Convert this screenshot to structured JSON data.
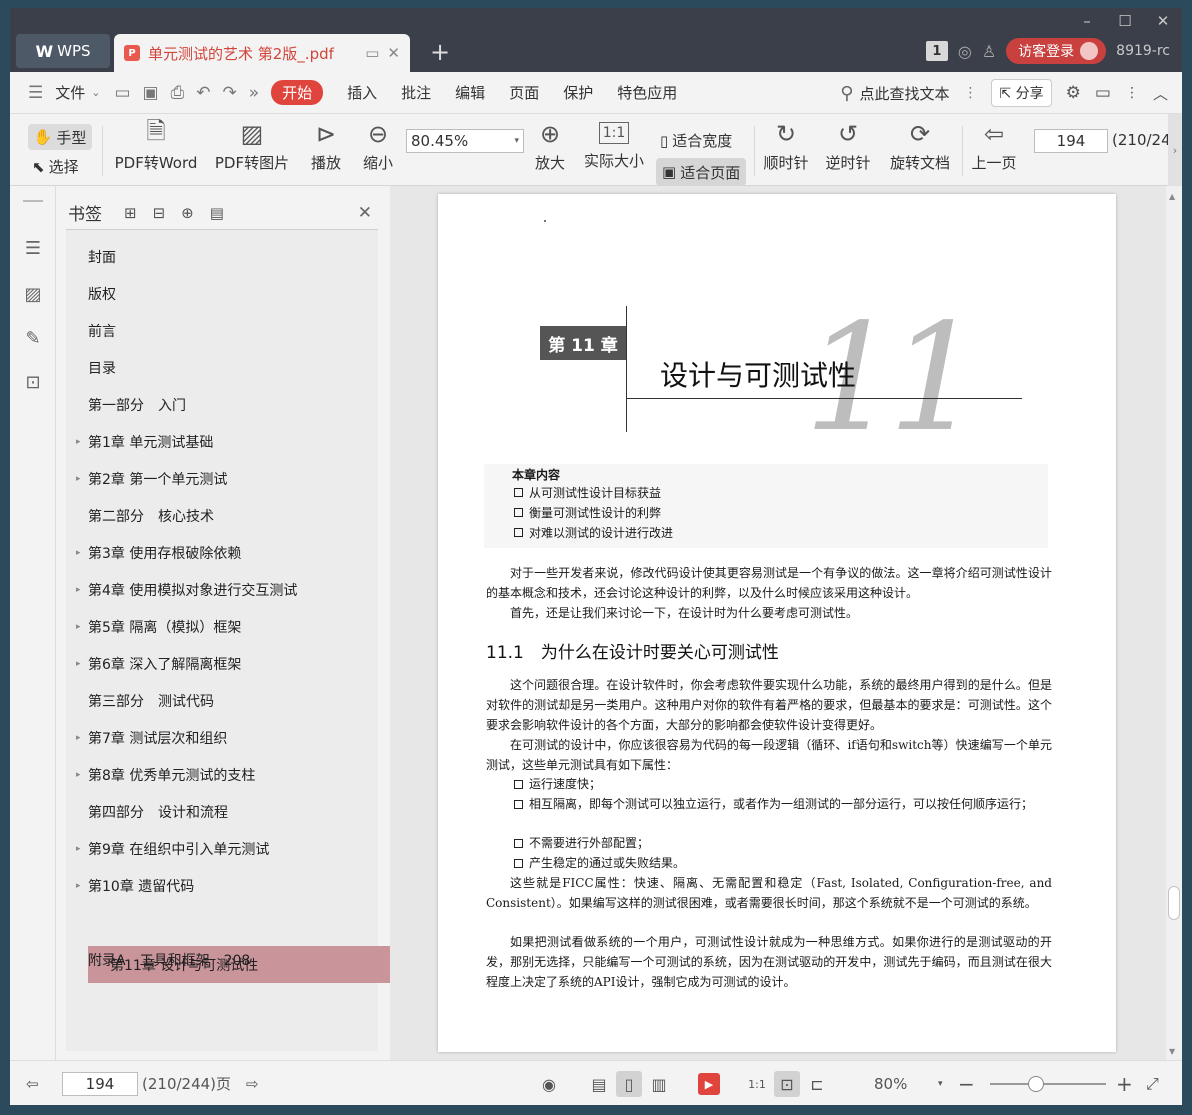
{
  "titlebar": {
    "app_tab": "WPS",
    "doc_tab": "单元测试的艺术 第2版_.pdf",
    "plus": "+",
    "num_badge": "1",
    "login": "访客登录",
    "version": "8919-rc",
    "win_min": "–",
    "win_max": "☐",
    "win_close": "✕"
  },
  "menu": {
    "file": "文件",
    "start": "开始",
    "insert": "插入",
    "annotate": "批注",
    "edit": "编辑",
    "page": "页面",
    "protect": "保护",
    "special": "特色应用",
    "search": "点此查找文本",
    "share": "分享"
  },
  "toolbar": {
    "hand": "手型",
    "select": "选择",
    "pdf_to_word": "PDF转Word",
    "pdf_to_image": "PDF转图片",
    "play": "播放",
    "zoom_out": "缩小",
    "zoom_value": "80.45%",
    "zoom_in": "放大",
    "actual_size": "实际大小",
    "fit_width": "适合宽度",
    "fit_page": "适合页面",
    "clockwise": "顺时针",
    "counterclockwise": "逆时针",
    "rotate_doc": "旋转文档",
    "prev_page": "上一页",
    "page_value": "194",
    "page_total": "(210/24"
  },
  "bookmarks": {
    "title": "书签",
    "items": [
      {
        "label": "封面",
        "expandable": false
      },
      {
        "label": "版权",
        "expandable": false
      },
      {
        "label": "前言",
        "expandable": false
      },
      {
        "label": "目录",
        "expandable": false
      },
      {
        "label": "第一部分　入门",
        "expandable": false
      },
      {
        "label": "第1章 单元测试基础",
        "expandable": true
      },
      {
        "label": "第2章 第一个单元测试",
        "expandable": true
      },
      {
        "label": "第二部分　核心技术",
        "expandable": false
      },
      {
        "label": "第3章 使用存根破除依赖",
        "expandable": true
      },
      {
        "label": "第4章 使用模拟对象进行交互测试",
        "expandable": true
      },
      {
        "label": "第5章 隔离（模拟）框架",
        "expandable": true
      },
      {
        "label": "第6章 深入了解隔离框架",
        "expandable": true
      },
      {
        "label": "第三部分　测试代码",
        "expandable": false
      },
      {
        "label": "第7章 测试层次和组织",
        "expandable": true
      },
      {
        "label": "第8章 优秀单元测试的支柱",
        "expandable": true
      },
      {
        "label": "第四部分　设计和流程",
        "expandable": false
      },
      {
        "label": "第9章 在组织中引入单元测试",
        "expandable": true
      },
      {
        "label": "第10章 遗留代码",
        "expandable": true
      },
      {
        "label": "第11章 设计与可测试性",
        "expandable": true,
        "selected": true
      },
      {
        "label": "附录A　工具和框架　208",
        "expandable": false
      }
    ]
  },
  "page": {
    "big_number": "11",
    "chapter_label": "第 11 章",
    "chapter_title": "设计与可测试性",
    "summary_head": "本章内容",
    "summary": [
      "从可测试性设计目标获益",
      "衡量可测试性设计的利弊",
      "对难以测试的设计进行改进"
    ],
    "p1": "对于一些开发者来说，修改代码设计使其更容易测试是一个有争议的做法。这一章将介绍可测试性设计的基本概念和技术，还会讨论这种设计的利弊，以及什么时候应该采用这种设计。",
    "p2": "首先，还是让我们来讨论一下，在设计时为什么要考虑可测试性。",
    "section": "11.1　为什么在设计时要关心可测试性",
    "p3": "这个问题很合理。在设计软件时，你会考虑软件要实现什么功能，系统的最终用户得到的是什么。但是对软件的测试却是另一类用户。这种用户对你的软件有着严格的要求，但最基本的要求是：可测试性。这个要求会影响软件设计的各个方面，大部分的影响都会使软件设计变得更好。",
    "p4": "在可测试的设计中，你应该很容易为代码的每一段逻辑（循环、if语句和switch等）快速编写一个单元测试，这些单元测试具有如下属性：",
    "bullets": [
      "运行速度快；",
      "相互隔离，即每个测试可以独立运行，或者作为一组测试的一部分运行，可以按任何顺序运行；",
      "不需要进行外部配置；",
      "产生稳定的通过或失败结果。"
    ],
    "p5": "这些就是FICC属性：快速、隔离、无需配置和稳定（Fast, Isolated, Configuration-free, and Consistent）。如果编写这样的测试很困难，或者需要很长时间，那这个系统就不是一个可测试的系统。",
    "p6": "如果把测试看做系统的一个用户，可测试性设计就成为一种思维方式。如果你进行的是测试驱动的开发，那别无选择，只能编写一个可测试的系统，因为在测试驱动的开发中，测试先于编码，而且测试在很大程度上决定了系统的API设计，强制它成为可测试的设计。"
  },
  "status": {
    "page_value": "194",
    "page_total": "(210/244)页",
    "zoom": "80%"
  }
}
